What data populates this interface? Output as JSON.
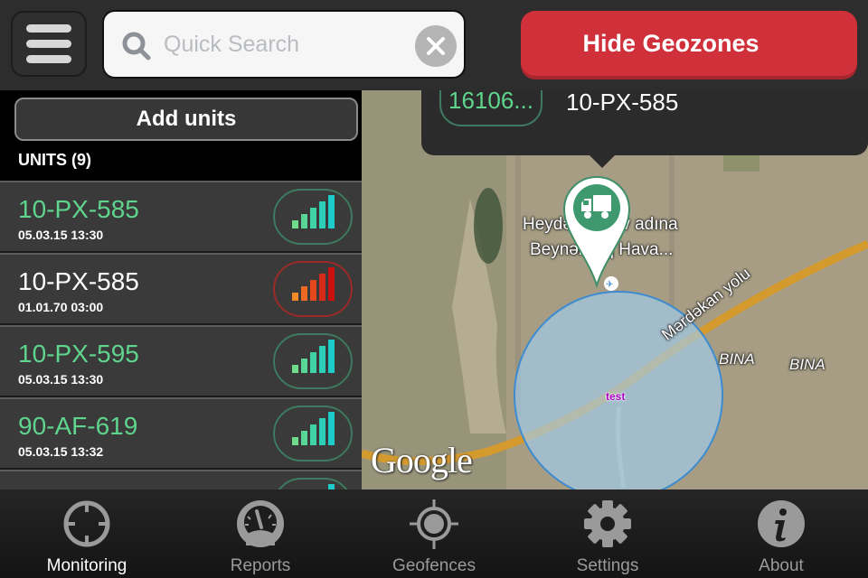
{
  "topbar": {
    "menu_icon": "hamburger-icon",
    "search": {
      "placeholder": "Quick Search",
      "value": ""
    },
    "hide_geozones_label": "Hide Geozones"
  },
  "units_panel": {
    "add_units_label": "Add units",
    "header": "UNITS (9)",
    "units": [
      {
        "name": "10-PX-585",
        "time": "05.03.15 13:30",
        "status": "online",
        "color": "#5fd48d"
      },
      {
        "name": "10-PX-585",
        "time": "01.01.70 03:00",
        "status": "offline",
        "color": "#ffffff"
      },
      {
        "name": "10-PX-595",
        "time": "05.03.15 13:30",
        "status": "online",
        "color": "#5fd48d"
      },
      {
        "name": "90-AF-619",
        "time": "05.03.15 13:32",
        "status": "online",
        "color": "#5fd48d"
      },
      {
        "name": "",
        "time": "",
        "status": "online",
        "color": "#5fd48d"
      }
    ]
  },
  "map": {
    "callout": {
      "id": "16106...",
      "name": "10-PX-585"
    },
    "labels": {
      "airport_line1": "Heydər Əliyev adına",
      "airport_line2": "Beynəlxalq Hava...",
      "road": "Mərdəkan yolu",
      "bina1": "BINA",
      "bina2": "BINA"
    },
    "geozone_label": "test",
    "attribution": "Google",
    "marker_icon": "truck-icon"
  },
  "tabs": [
    {
      "label": "Monitoring",
      "icon": "crosshair-icon",
      "active": true
    },
    {
      "label": "Reports",
      "icon": "gauge-icon",
      "active": false
    },
    {
      "label": "Geofences",
      "icon": "target-icon",
      "active": false
    },
    {
      "label": "Settings",
      "icon": "gear-icon",
      "active": false
    },
    {
      "label": "About",
      "icon": "info-icon",
      "active": false
    }
  ],
  "colors": {
    "accent_red": "#d0303a",
    "online_green": "#5fd48d",
    "offline_red": "#9a2b27"
  }
}
